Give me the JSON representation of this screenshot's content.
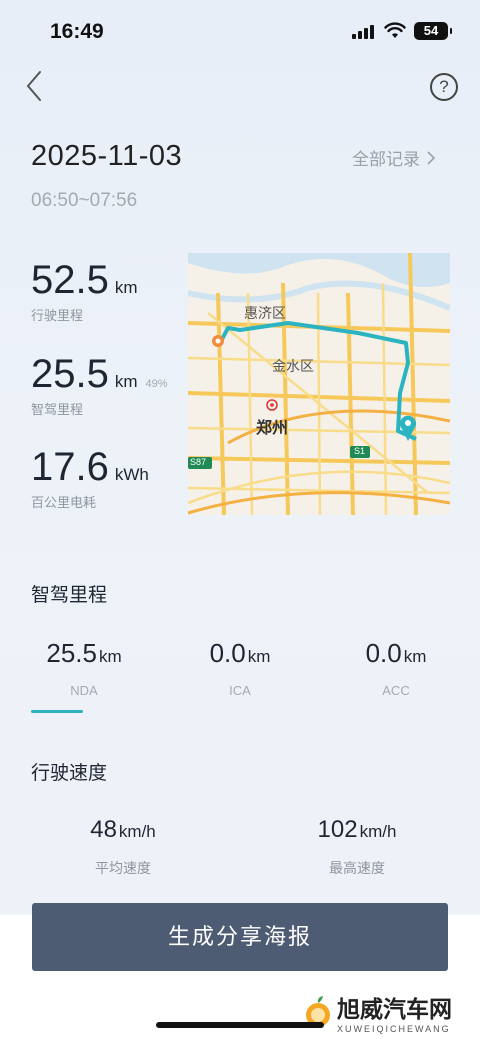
{
  "status_bar": {
    "time": "16:49",
    "battery": "54"
  },
  "header": {
    "back_icon": "chevron-left-icon",
    "help_icon": "question-circle-icon",
    "help_glyph": "?"
  },
  "trip": {
    "date": "2025-11-03",
    "all_records": "全部记录",
    "time_range": "06:50~07:56"
  },
  "stats": [
    {
      "value": "52.5",
      "unit": "km",
      "label": "行驶里程",
      "pct": ""
    },
    {
      "value": "25.5",
      "unit": "km",
      "label": "智驾里程",
      "pct": "49%"
    },
    {
      "value": "17.6",
      "unit": "kWh",
      "label": "百公里电耗",
      "pct": ""
    }
  ],
  "map": {
    "labels": {
      "district1": "惠济区",
      "district2": "金水区",
      "city": "郑州",
      "road1": "S87",
      "road2": "S1"
    },
    "colors": {
      "route": "#2ab3c0",
      "start": "#f28c3a",
      "end": "#2ab3c0"
    }
  },
  "smart_driving": {
    "title": "智驾里程",
    "tabs": [
      {
        "value": "25.5",
        "unit": "km",
        "label": "NDA"
      },
      {
        "value": "0.0",
        "unit": "km",
        "label": "ICA"
      },
      {
        "value": "0.0",
        "unit": "km",
        "label": "ACC"
      }
    ],
    "accent": "#2ab3c0"
  },
  "speed": {
    "title": "行驶速度",
    "items": [
      {
        "value": "48",
        "unit": "km/h",
        "label": "平均速度"
      },
      {
        "value": "102",
        "unit": "km/h",
        "label": "最高速度"
      }
    ]
  },
  "cta": {
    "label": "生成分享海报"
  },
  "watermark": {
    "title": "旭威汽车网",
    "subtitle": "XUWEIQICHEWANG"
  }
}
